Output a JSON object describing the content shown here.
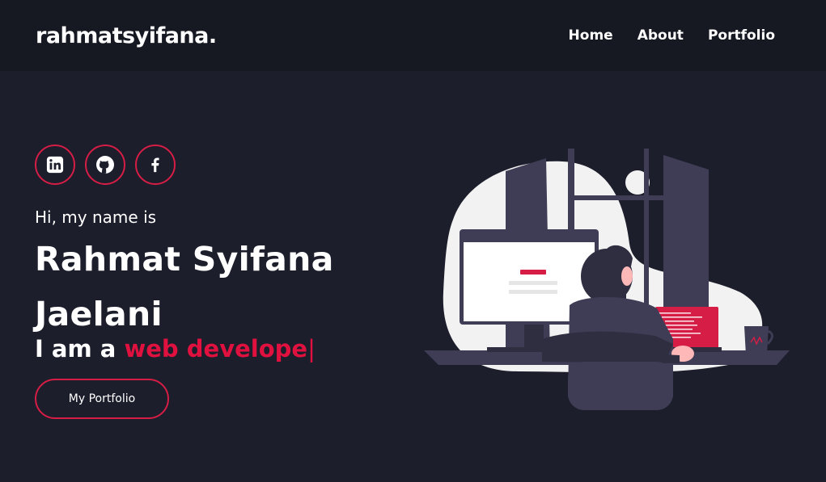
{
  "brand": "rahmatsyifana.",
  "nav": {
    "items": [
      "Home",
      "About",
      "Portfolio"
    ]
  },
  "socials": [
    "linkedin-icon",
    "github-icon",
    "facebook-icon"
  ],
  "hero": {
    "greeting": "Hi, my name is",
    "name_line1": "Rahmat Syifana",
    "name_line2": "Jaelani",
    "role_prefix": "I am a",
    "role_typed": "web develope",
    "cursor": "|",
    "cta_label": "My Portfolio"
  },
  "colors": {
    "accent": "#d61d45",
    "background": "#1c1e2c",
    "navbar": "#161822"
  }
}
